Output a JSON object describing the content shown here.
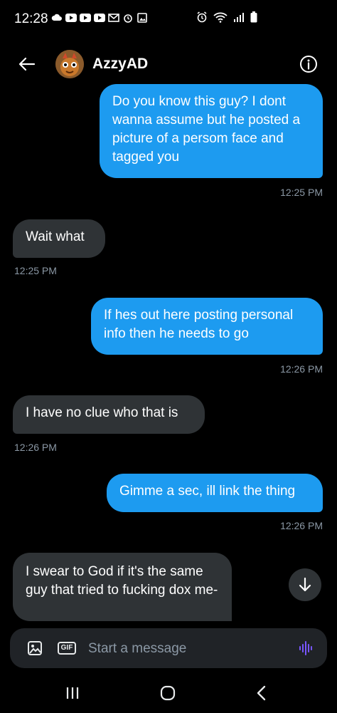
{
  "status_bar": {
    "time": "12:28"
  },
  "header": {
    "contact_name": "AzzyAD"
  },
  "messages": [
    {
      "direction": "out",
      "text": "Do you know this guy? I dont wanna assume but he posted a picture of a persom face and tagged you",
      "time": "12:25 PM"
    },
    {
      "direction": "in",
      "text": "Wait what",
      "time": "12:25 PM"
    },
    {
      "direction": "out",
      "text": "If hes out here posting personal info then he needs to go",
      "time": "12:26 PM"
    },
    {
      "direction": "in",
      "text": "I have no clue who that is",
      "time": "12:26 PM"
    },
    {
      "direction": "out",
      "text": "Gimme a sec, ill link the thing",
      "time": "12:26 PM"
    },
    {
      "direction": "in",
      "text": "I swear to God if it's the same guy that tried to fucking dox me-",
      "time": ""
    }
  ],
  "composer": {
    "placeholder": "Start a message",
    "gif_label": "GIF"
  },
  "colors": {
    "outgoing_bubble": "#1d9bf0",
    "incoming_bubble": "#2f3336",
    "background": "#000000",
    "timestamp": "#8b98a5",
    "voice_accent": "#7856ff"
  }
}
